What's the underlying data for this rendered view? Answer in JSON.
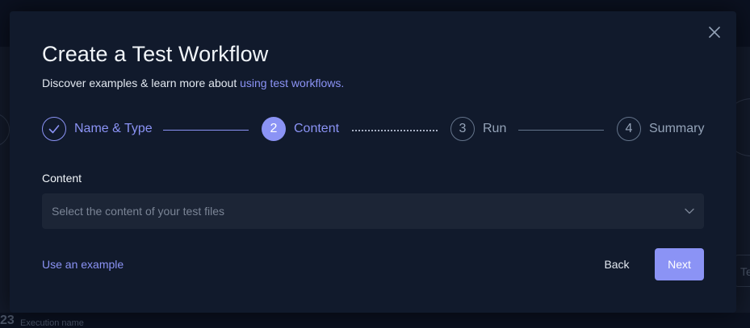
{
  "modal": {
    "title": "Create a Test Workflow",
    "subtitle_prefix": "Discover examples & learn more about ",
    "subtitle_link": "using test workflows."
  },
  "steps": [
    {
      "number": "1",
      "label": "Name & Type",
      "state": "completed"
    },
    {
      "number": "2",
      "label": "Content",
      "state": "active"
    },
    {
      "number": "3",
      "label": "Run",
      "state": "pending"
    },
    {
      "number": "4",
      "label": "Summary",
      "state": "pending"
    }
  ],
  "content_field": {
    "label": "Content",
    "placeholder": "Select the content of your test files"
  },
  "footer": {
    "example_link": "Use an example",
    "back_label": "Back",
    "next_label": "Next"
  },
  "background": {
    "number": "23",
    "caption": "Execution name",
    "button_text": "Te"
  },
  "colors": {
    "accent": "#8b93f5",
    "modal_bg": "#111a2c",
    "page_bg": "#0b1120",
    "input_bg": "#1c2536"
  }
}
